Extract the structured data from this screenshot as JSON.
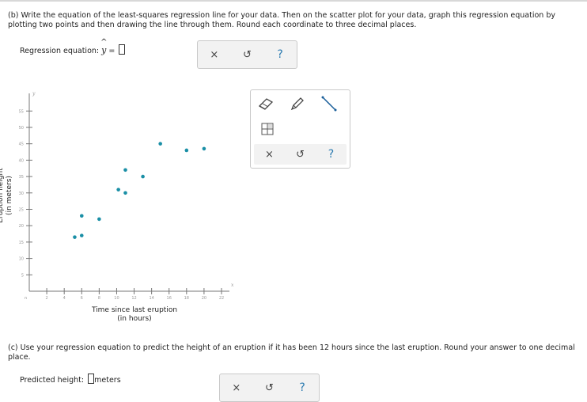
{
  "part_b": {
    "instruction": "(b) Write the equation of the least-squares regression line for your data. Then on the scatter plot for your data, graph this regression equation by plotting two points and then drawing the line through them. Round each coordinate to three decimal places.",
    "regression_label": "Regression equation:",
    "yhat_symbol": "y",
    "yhat_accent": "^",
    "equals": "="
  },
  "part_c": {
    "instruction": "(c) Use your regression equation to predict the height of an eruption if it has been 12 hours since the last eruption. Round your answer to one decimal place.",
    "predicted_label": "Predicted height:",
    "unit": "meters"
  },
  "toolbar": {
    "clear": "×",
    "undo": "↺",
    "help": "?"
  },
  "graph_tools": {
    "eraser": "eraser-icon",
    "pencil": "pencil-icon",
    "line": "line-tool-icon",
    "grid": "grid-icon",
    "clear": "×",
    "undo": "↺",
    "help": "?"
  },
  "chart_data": {
    "type": "scatter",
    "xlabel": "Time since last eruption\n(in hours)",
    "ylabel": "Eruption height\n(in meters)",
    "xlim": [
      0,
      24
    ],
    "ylim": [
      0,
      57
    ],
    "x_ticks": [
      2,
      4,
      6,
      8,
      10,
      12,
      14,
      16,
      18,
      20,
      22
    ],
    "y_ticks": [
      5,
      10,
      15,
      20,
      25,
      30,
      35,
      40,
      45,
      50,
      55
    ],
    "x_axis_name": "x",
    "y_axis_name": "y",
    "origin_label": "0",
    "point_color": "#1a8fa6",
    "points": [
      [
        5.2,
        16.5
      ],
      [
        6.0,
        17.0
      ],
      [
        6.0,
        23.0
      ],
      [
        8.0,
        22.0
      ],
      [
        10.2,
        31.0
      ],
      [
        11.0,
        30.0
      ],
      [
        11.0,
        37.0
      ],
      [
        13.0,
        35.0
      ],
      [
        15.0,
        45.0
      ],
      [
        18.0,
        43.0
      ],
      [
        20.0,
        43.5
      ]
    ]
  }
}
